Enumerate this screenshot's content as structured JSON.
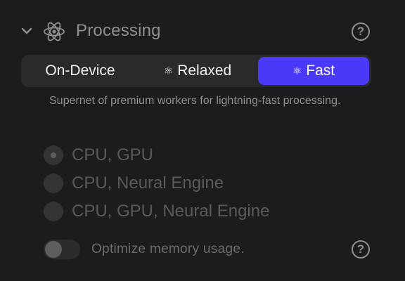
{
  "section": {
    "title": "Processing",
    "icon": "atom-icon",
    "collapse_icon": "chevron-down-icon",
    "help_icon": "help-icon"
  },
  "modes": {
    "options": [
      {
        "label": "On-Device",
        "icon": ""
      },
      {
        "label": "Relaxed",
        "icon": "⚛"
      },
      {
        "label": "Fast",
        "icon": "⚛"
      }
    ],
    "selected": "Fast",
    "accent_color": "#4a3af7"
  },
  "description": "Supernet of premium workers for lightning-fast processing.",
  "compute_units": {
    "options": [
      {
        "label": "CPU, GPU",
        "checked": true
      },
      {
        "label": "CPU, Neural Engine",
        "checked": false
      },
      {
        "label": "CPU, GPU, Neural Engine",
        "checked": false
      }
    ],
    "disabled": true
  },
  "optimize_memory": {
    "label": "Optimize memory usage.",
    "enabled": false,
    "help_icon": "help-icon"
  }
}
